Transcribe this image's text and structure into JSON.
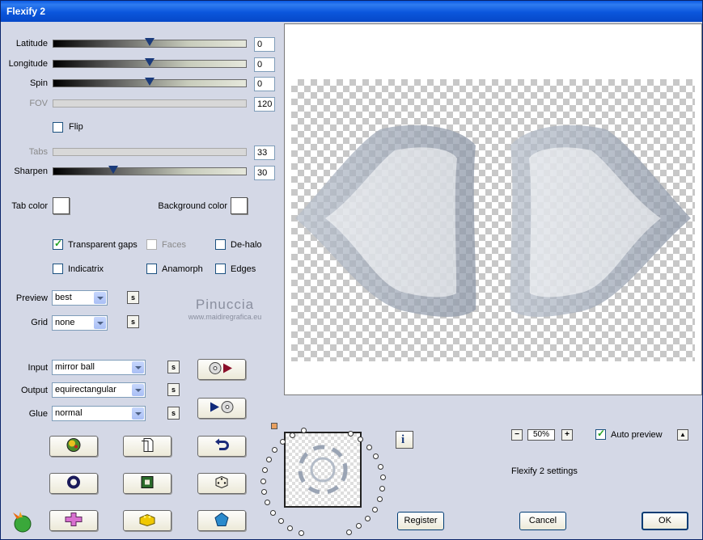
{
  "window": {
    "title": "Flexify 2"
  },
  "sliders": [
    {
      "label": "Latitude",
      "value": "0",
      "level": 0.5,
      "enabled": true
    },
    {
      "label": "Longitude",
      "value": "0",
      "level": 0.5,
      "enabled": true
    },
    {
      "label": "Spin",
      "value": "0",
      "level": 0.5,
      "enabled": true
    },
    {
      "label": "FOV",
      "value": "120",
      "level": null,
      "enabled": false
    }
  ],
  "flip": {
    "label": "Flip",
    "checked": false
  },
  "tabs": {
    "label": "Tabs",
    "value": "33",
    "enabled": false
  },
  "sharpen": {
    "label": "Sharpen",
    "value": "30",
    "level": 0.3
  },
  "colors": {
    "tab_color_label": "Tab color",
    "background_color_label": "Background color",
    "tab_color": "#ffffff",
    "background_color": "#ffffff"
  },
  "options": [
    {
      "label": "Transparent gaps",
      "checked": true,
      "enabled": true
    },
    {
      "label": "Faces",
      "checked": false,
      "enabled": false
    },
    {
      "label": "De-halo",
      "checked": false,
      "enabled": true
    },
    {
      "label": "Indicatrix",
      "checked": false,
      "enabled": true
    },
    {
      "label": "Anamorph",
      "checked": false,
      "enabled": true
    },
    {
      "label": "Edges",
      "checked": false,
      "enabled": true
    }
  ],
  "preview_select": {
    "label": "Preview",
    "value": "best"
  },
  "grid_select": {
    "label": "Grid",
    "value": "none"
  },
  "watermark": {
    "name": "Pinuccia",
    "url": "www.maidiregrafica.eu"
  },
  "input_select": {
    "label": "Input",
    "value": "mirror ball"
  },
  "output_select": {
    "label": "Output",
    "value": "equirectangular"
  },
  "glue_select": {
    "label": "Glue",
    "value": "normal"
  },
  "s_label": "s",
  "zoom": {
    "value": "50%",
    "minus": "−",
    "plus": "+"
  },
  "auto_preview": {
    "label": "Auto preview",
    "checked": true
  },
  "up_label": "▲",
  "settings_text": "Flexify 2 settings",
  "buttons": {
    "register": "Register",
    "cancel": "Cancel",
    "ok": "OK"
  },
  "icons": {
    "tools": [
      "globe-color-icon",
      "page-icon",
      "undo-icon",
      "ring-icon",
      "square-frame-icon",
      "dice-icon",
      "cross-shape-icon",
      "yellow-block-icon",
      "pentagon-icon"
    ],
    "info": "info-icon",
    "logo": "flaming-star-logo-icon",
    "cd_play": "cd-play-icon",
    "play_cd": "play-cd-icon"
  }
}
